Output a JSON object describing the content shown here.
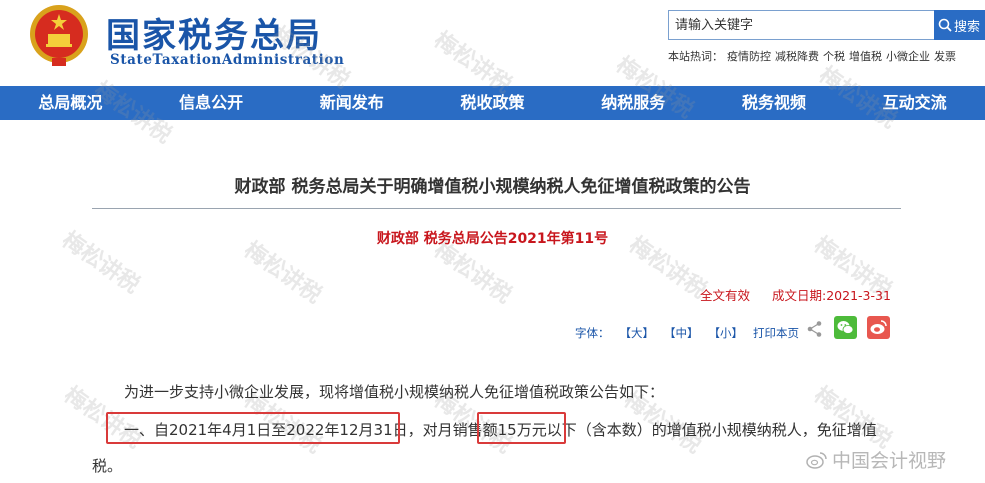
{
  "header": {
    "title": "国家税务总局",
    "subtitle": "StateTaxationAdministration",
    "search": {
      "placeholder": "请输入关键字",
      "button_label": "搜索"
    },
    "hotwords_label": "本站热词：",
    "hotwords": [
      "疫情防控",
      "减税降费",
      "个税",
      "增值税",
      "小微企业",
      "发票"
    ]
  },
  "nav": {
    "items": [
      "总局概况",
      "信息公开",
      "新闻发布",
      "税收政策",
      "纳税服务",
      "税务视频",
      "互动交流"
    ]
  },
  "article": {
    "title": "财政部 税务总局关于明确增值税小规模纳税人免征增值税政策的公告",
    "doc_number": "财政部 税务总局公告2021年第11号",
    "validity": "全文有效",
    "date_label": "成文日期:2021-3-31",
    "toolbar": {
      "font_label": "字体：",
      "large": "【大】",
      "medium": "【中】",
      "small": "【小】",
      "print": "打印本页"
    },
    "para1": "为进一步支持小微企业发展，现将增值税小规模纳税人免征增值税政策公告如下：",
    "para2_part1": "一、自2021年4月1日至2022年12月31日",
    "para2_part2": "，对月销售额",
    "para2_part3": "15万元以下",
    "para2_part4": "（含本数）的增值税小规模纳税人，免征增值",
    "para2_line2": "税。"
  },
  "watermark": {
    "text": "梅松讲税",
    "brand": "中国会计视野"
  },
  "colors": {
    "brand_blue": "#1a55a8",
    "nav_blue": "#2a6cc4",
    "red": "#c8161d",
    "highlight_box": "#d93a3a"
  }
}
